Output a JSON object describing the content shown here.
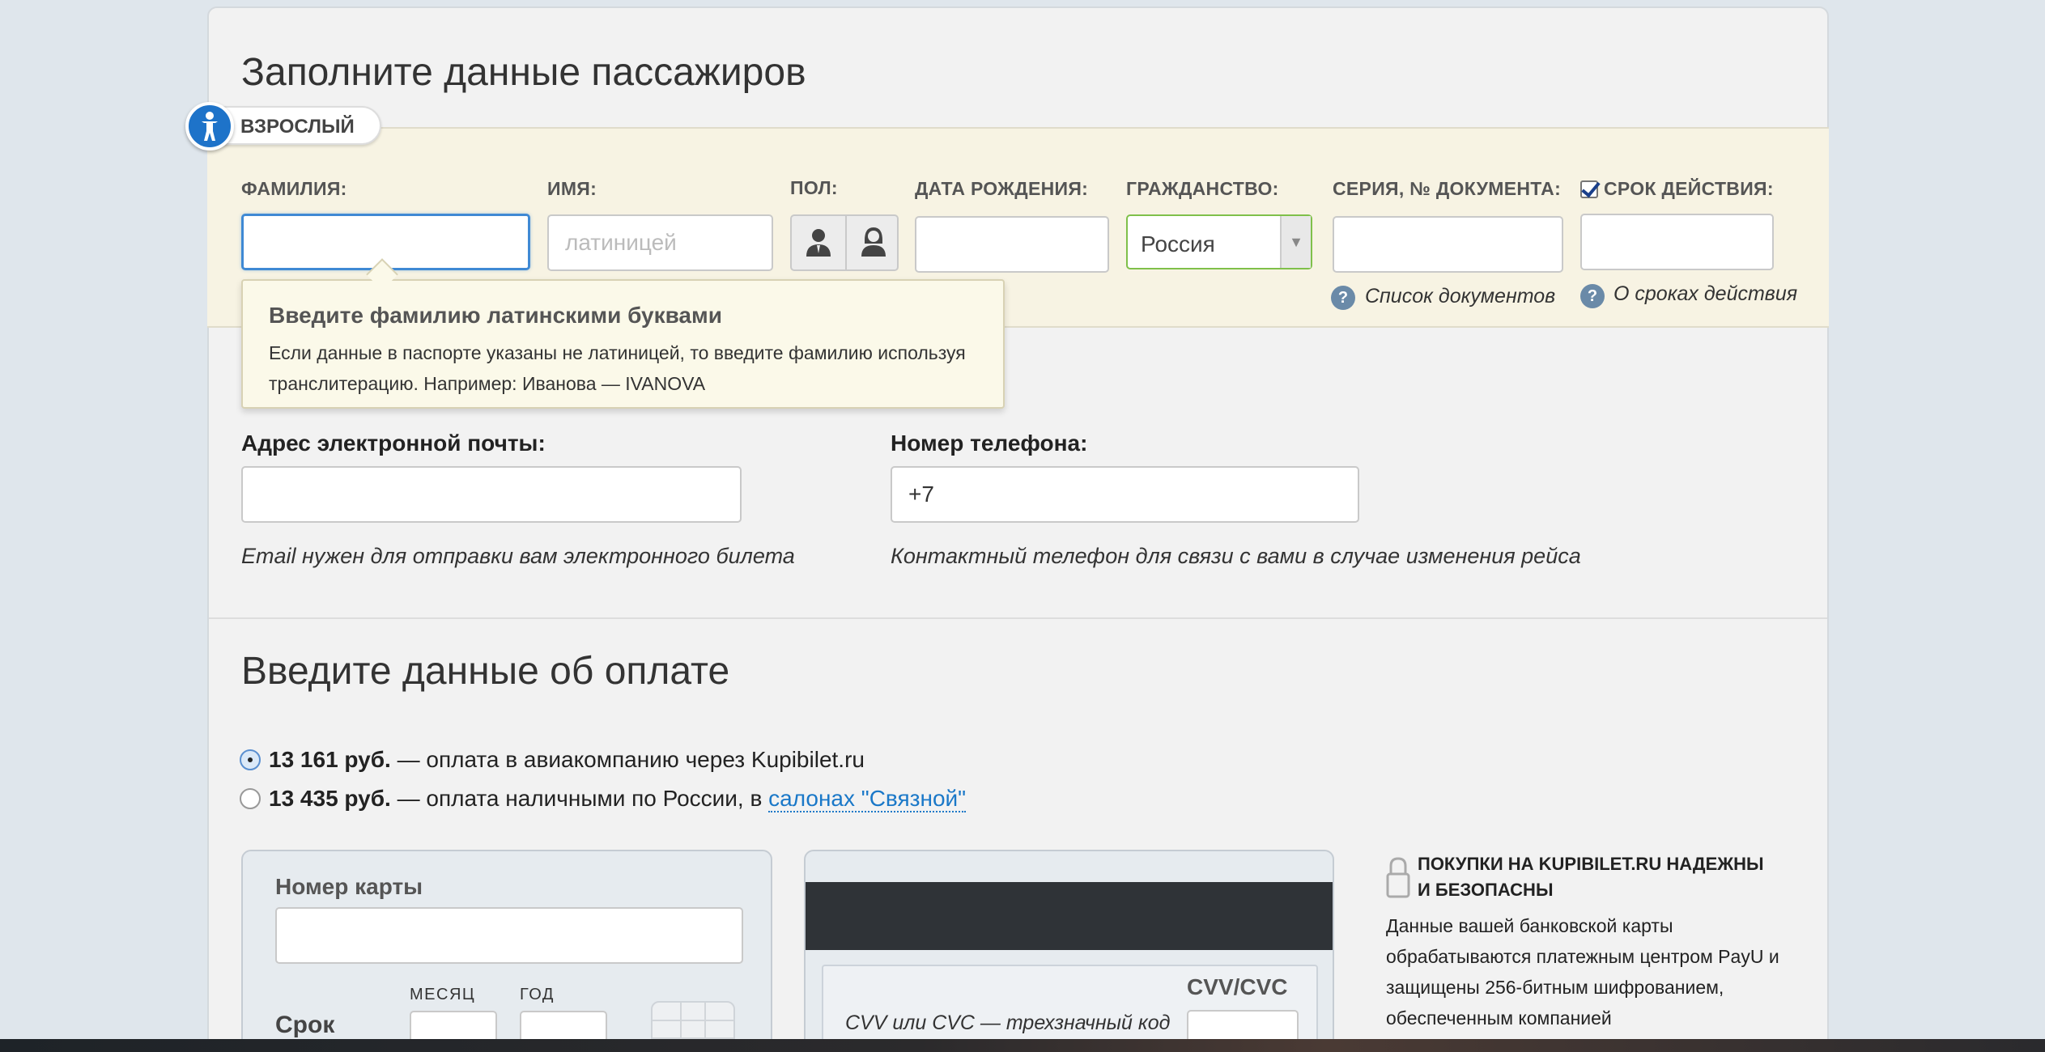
{
  "passengers": {
    "title": "Заполните данные пассажиров",
    "passenger_type": "ВЗРОСЛЫЙ",
    "fields": {
      "surname_label": "ФАМИЛИЯ:",
      "name_label": "ИМЯ:",
      "name_placeholder": "латиницей",
      "gender_label": "ПОЛ:",
      "birthdate_label": "ДАТА РОЖДЕНИЯ:",
      "citizenship_label": "ГРАЖДАНСТВО:",
      "citizenship_value": "Россия",
      "document_label": "СЕРИЯ, № ДОКУМЕНТА:",
      "validity_label": "СРОК ДЕЙСТВИЯ:"
    },
    "help": {
      "documents_link": "Список документов",
      "validity_link": "О сроках действия"
    },
    "tooltip": {
      "title": "Введите фамилию латинскими буквами",
      "text": "Если данные в паспорте указаны не латиницей, то введите фамилию используя транслитерацию. Например: Иванова — IVANOVA"
    }
  },
  "contacts": {
    "email_label": "Адрес электронной почты:",
    "email_note": "Email нужен для отправки вам электронного билета",
    "phone_label": "Номер телефона:",
    "phone_prefix": "+7",
    "phone_note": "Контактный телефон для связи с вами в случае изменения рейса"
  },
  "payment": {
    "title": "Введите данные об оплате",
    "option1": {
      "amount": "13 161 руб.",
      "text": " — оплата в авиакомпанию через Kupibilet.ru",
      "checked": true
    },
    "option2": {
      "amount": "13 435 руб.",
      "text": " — оплата наличными по России, в ",
      "link": "салонах \"Связной\"",
      "checked": false
    },
    "card": {
      "number_label": "Номер карты",
      "expiry_label": "Срок",
      "month_label": "МЕСЯЦ",
      "year_label": "ГОД",
      "cvv_label": "CVV/CVC",
      "cvv_hint": "CVV или CVC — трехзначный код"
    },
    "security": {
      "title": "ПОКУПКИ НА KUPIBILET.RU НАДЕЖНЫ И БЕЗОПАСНЫ",
      "text": "Данные вашей банковской карты обрабатываются платежным центром PayU и защищены 256-битным шифрованием, обеспеченным компанией"
    }
  },
  "colors": {
    "accent_blue": "#1e73c9",
    "link_blue": "#1a78c8",
    "passenger_band": "#f7f3e3",
    "citizenship_border": "#7fc04a"
  }
}
